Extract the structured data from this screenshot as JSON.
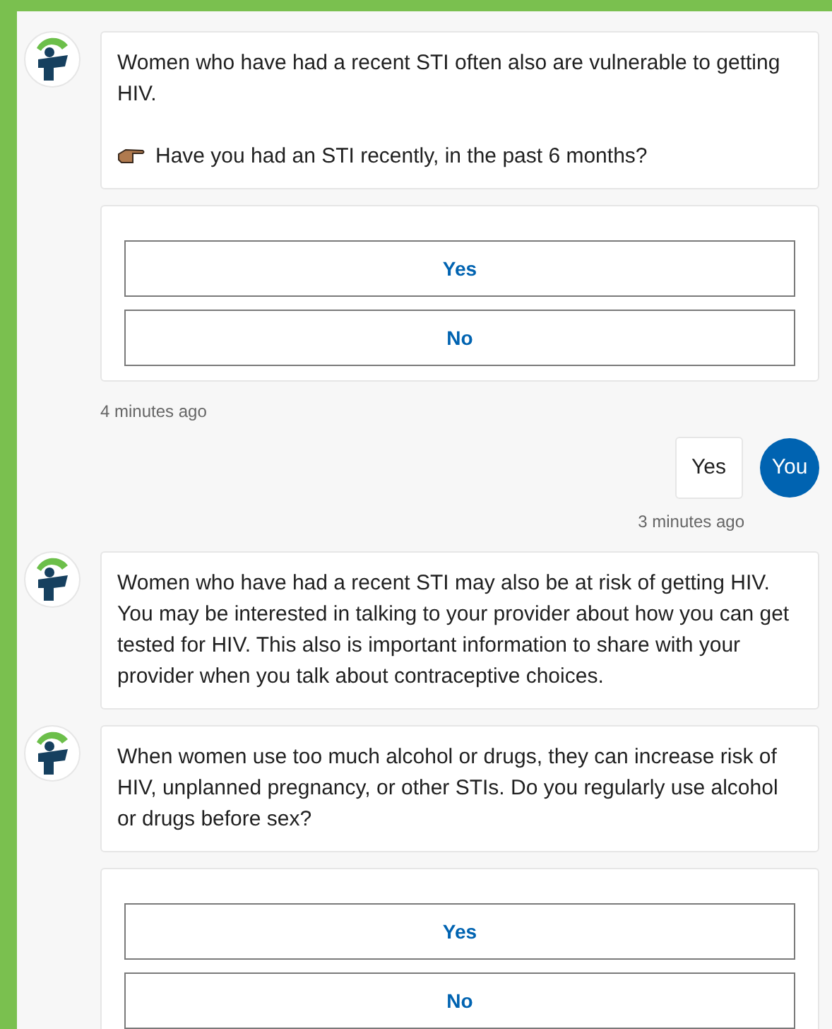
{
  "messages": [
    {
      "kind": "bot",
      "paragraphs": [
        "Women who have had a recent STI often also are vulnerable to getting HIV."
      ],
      "prompt": "Have you had an STI recently, in the past 6 months?"
    },
    {
      "kind": "choices",
      "options": [
        "Yes",
        "No"
      ]
    },
    {
      "kind": "bot_time",
      "text": "4 minutes ago"
    },
    {
      "kind": "user",
      "text": "Yes",
      "avatar": "You"
    },
    {
      "kind": "user_time",
      "text": "3 minutes ago"
    },
    {
      "kind": "bot",
      "paragraphs": [
        "Women who have had a recent STI may also be at risk of getting HIV. You may be interested in talking to your provider about how you can get tested for HIV. This also is important information to share with your provider when you talk about contraceptive choices."
      ]
    },
    {
      "kind": "bot",
      "paragraphs": [
        "When women use too much alcohol or drugs, they can increase risk of HIV, unplanned pregnancy, or other STIs. Do you regularly use alcohol or drugs before sex?"
      ]
    },
    {
      "kind": "choices",
      "options": [
        "Yes",
        "No"
      ]
    }
  ]
}
